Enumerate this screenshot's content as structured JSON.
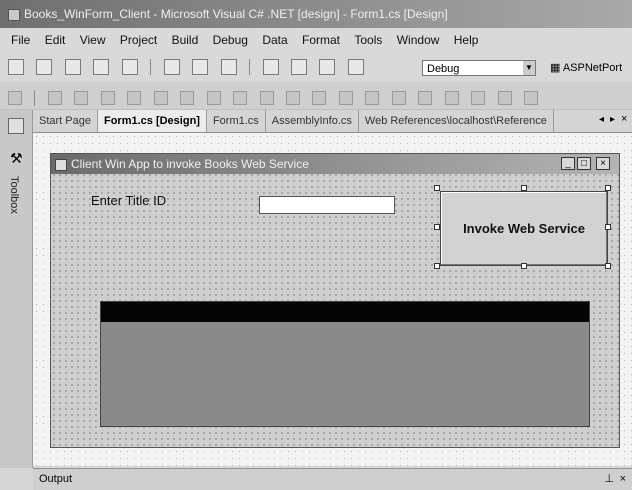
{
  "window": {
    "title": "Books_WinForm_Client - Microsoft Visual C# .NET [design] - Form1.cs [Design]"
  },
  "menu": [
    "File",
    "Edit",
    "View",
    "Project",
    "Build",
    "Debug",
    "Data",
    "Format",
    "Tools",
    "Window",
    "Help"
  ],
  "toolbar": {
    "configuration": "Debug",
    "project": "ASPNetPort"
  },
  "toolbox": {
    "label": "Toolbox"
  },
  "tabs": [
    {
      "label": "Start Page",
      "active": false
    },
    {
      "label": "Form1.cs [Design]",
      "active": true
    },
    {
      "label": "Form1.cs",
      "active": false
    },
    {
      "label": "AssemblyInfo.cs",
      "active": false
    },
    {
      "label": "Web References\\localhost\\Reference",
      "active": false
    }
  ],
  "tab_nav": {
    "prev": "◂",
    "next": "▸",
    "close": "×"
  },
  "form": {
    "title": "Client Win App to invoke Books Web Service",
    "window_buttons": {
      "minimize": "_",
      "maximize": "□",
      "close": "×"
    },
    "label_title_id": "Enter Title ID",
    "title_input_value": "",
    "invoke_button": "Invoke Web Service"
  },
  "output": {
    "label": "Output",
    "pin": "⊥",
    "close": "×"
  },
  "colors": {
    "ide_chrome": "#d6d6d6",
    "title_bar": "#6f6f6f",
    "grid_header": "#050505",
    "grid_body": "#8a8a8a"
  }
}
